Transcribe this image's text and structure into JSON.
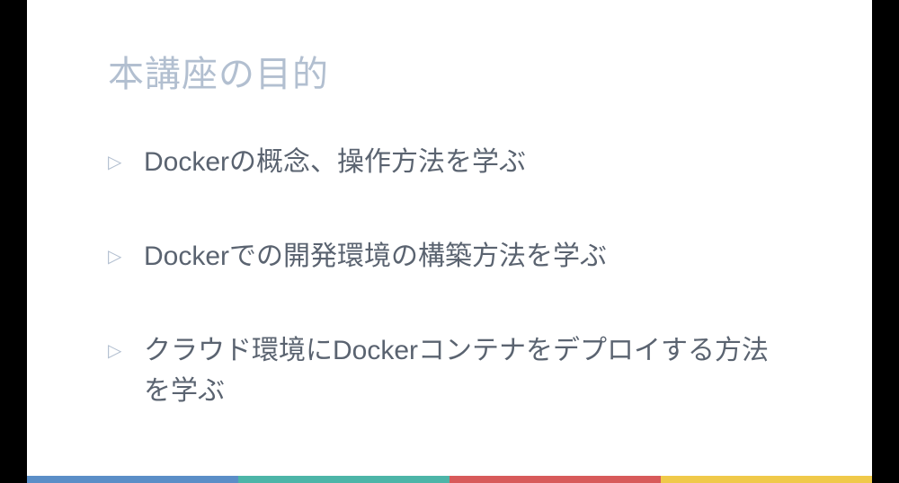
{
  "slide": {
    "title": "本講座の目的",
    "bullets": [
      "Dockerの概念、操作方法を学ぶ",
      "Dockerでの開発環境の構築方法を学ぶ",
      "クラウド環境にDockerコンテナをデプロイする方法を学ぶ"
    ]
  }
}
